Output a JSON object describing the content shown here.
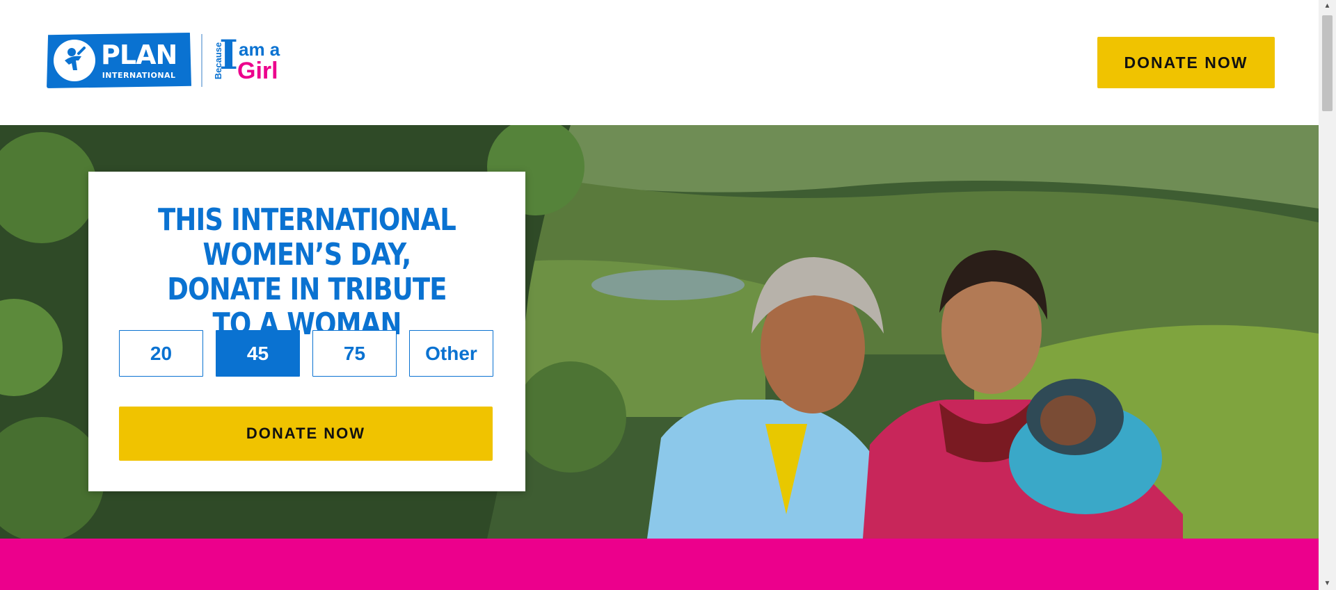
{
  "header": {
    "logo": {
      "plan_word": "PLAN",
      "plan_sub": "INTERNATIONAL",
      "because": "Because",
      "i_letter": "I",
      "am_a": "am a",
      "girl": "Girl"
    },
    "donate_label": "DONATE NOW"
  },
  "hero": {
    "card": {
      "title": "THIS INTERNATIONAL WOMEN’S DAY, DONATE IN TRIBUTE TO A WOMAN",
      "amounts": [
        "20",
        "45",
        "75",
        "Other"
      ],
      "selected_amount": "45",
      "donate_label": "DONATE NOW"
    },
    "photo_description_icon": "photo-women-with-baby"
  },
  "colors": {
    "brand_blue": "#0a72d1",
    "donate_yellow": "#f0c300",
    "brand_pink": "#ec008c"
  },
  "scrollbar": {
    "up_icon": "scroll-up-arrow-icon",
    "down_icon": "scroll-down-arrow-icon"
  }
}
